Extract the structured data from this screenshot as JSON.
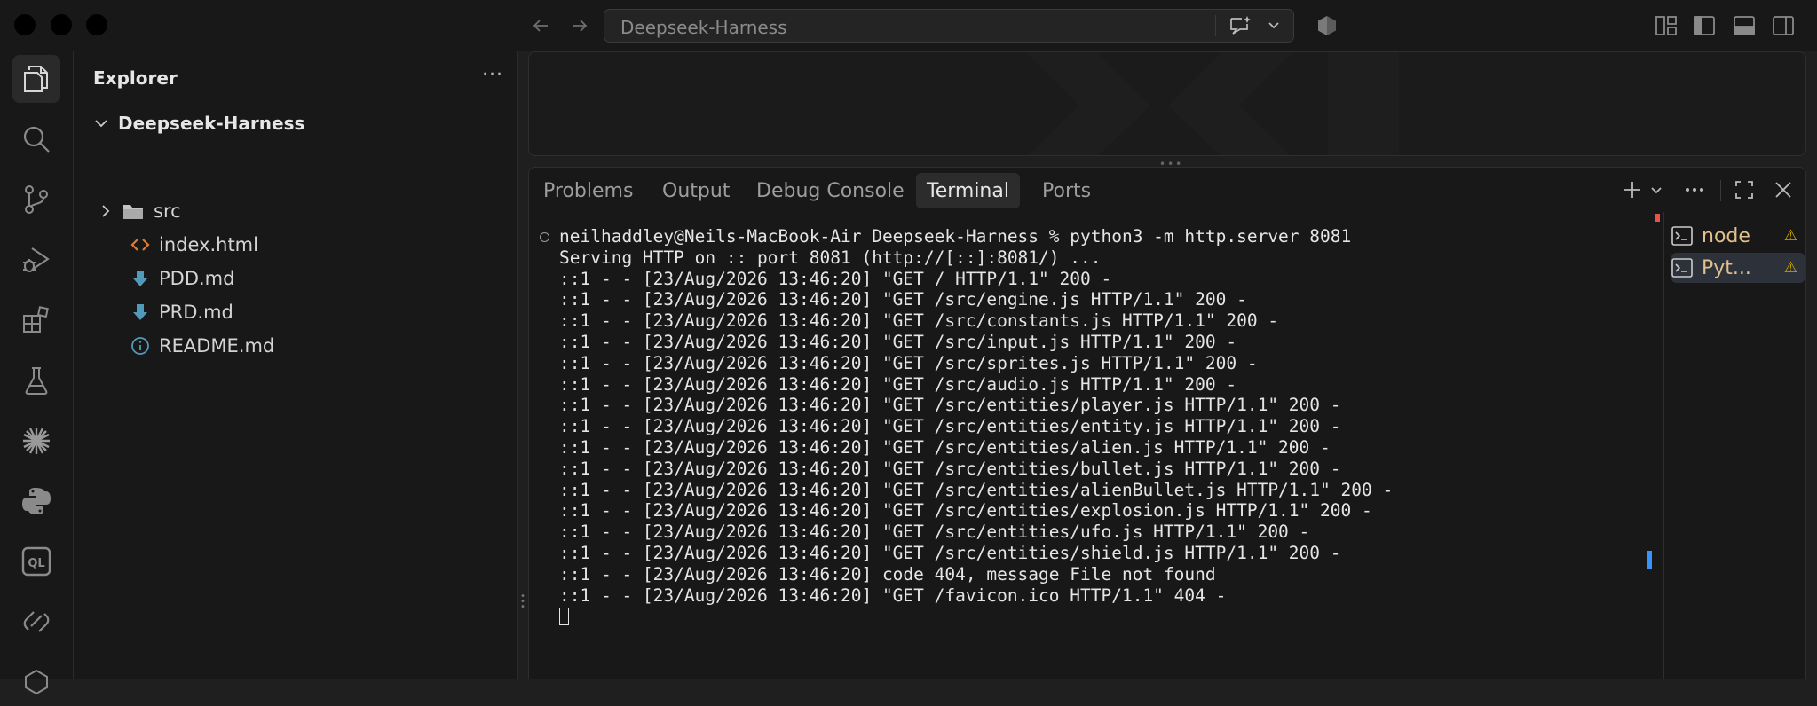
{
  "titlebar": {
    "search_text": "Deepseek-Harness"
  },
  "activity_bar": {
    "items": [
      "explorer",
      "search",
      "source-control",
      "run-debug",
      "extensions",
      "testing",
      "ai-assistant",
      "python",
      "codeql",
      "remote"
    ]
  },
  "sidebar": {
    "title": "Explorer",
    "more": "···",
    "workspace": "Deepseek-Harness",
    "items": [
      {
        "label": "src",
        "icon": "folder-icon",
        "type": "folder"
      },
      {
        "label": "index.html",
        "icon": "html-file-icon",
        "type": "file"
      },
      {
        "label": "PDD.md",
        "icon": "markdown-download-icon",
        "type": "file"
      },
      {
        "label": "PRD.md",
        "icon": "markdown-download-icon",
        "type": "file"
      },
      {
        "label": "README.md",
        "icon": "info-icon",
        "type": "file"
      }
    ]
  },
  "panel": {
    "tabs": [
      "Problems",
      "Output",
      "Debug Console",
      "Terminal",
      "Ports"
    ],
    "active_tab": "Terminal",
    "terminal_lines": [
      "neilhaddley@Neils-MacBook-Air Deepseek-Harness % python3 -m http.server 8081",
      "Serving HTTP on :: port 8081 (http://[::]:8081/) ...",
      "::1 - - [23/Aug/2026 13:46:20] \"GET / HTTP/1.1\" 200 -",
      "::1 - - [23/Aug/2026 13:46:20] \"GET /src/engine.js HTTP/1.1\" 200 -",
      "::1 - - [23/Aug/2026 13:46:20] \"GET /src/constants.js HTTP/1.1\" 200 -",
      "::1 - - [23/Aug/2026 13:46:20] \"GET /src/input.js HTTP/1.1\" 200 -",
      "::1 - - [23/Aug/2026 13:46:20] \"GET /src/sprites.js HTTP/1.1\" 200 -",
      "::1 - - [23/Aug/2026 13:46:20] \"GET /src/audio.js HTTP/1.1\" 200 -",
      "::1 - - [23/Aug/2026 13:46:20] \"GET /src/entities/player.js HTTP/1.1\" 200 -",
      "::1 - - [23/Aug/2026 13:46:20] \"GET /src/entities/entity.js HTTP/1.1\" 200 -",
      "::1 - - [23/Aug/2026 13:46:20] \"GET /src/entities/alien.js HTTP/1.1\" 200 -",
      "::1 - - [23/Aug/2026 13:46:20] \"GET /src/entities/bullet.js HTTP/1.1\" 200 -",
      "::1 - - [23/Aug/2026 13:46:20] \"GET /src/entities/alienBullet.js HTTP/1.1\" 200 -",
      "::1 - - [23/Aug/2026 13:46:20] \"GET /src/entities/explosion.js HTTP/1.1\" 200 -",
      "::1 - - [23/Aug/2026 13:46:20] \"GET /src/entities/ufo.js HTTP/1.1\" 200 -",
      "::1 - - [23/Aug/2026 13:46:20] \"GET /src/entities/shield.js HTTP/1.1\" 200 -",
      "::1 - - [23/Aug/2026 13:46:20] code 404, message File not found",
      "::1 - - [23/Aug/2026 13:46:20] \"GET /favicon.ico HTTP/1.1\" 404 -"
    ],
    "sessions": [
      {
        "label": "node",
        "icon": "terminal-icon",
        "status": "warning-icon"
      },
      {
        "label": "Pyt...",
        "icon": "terminal-icon",
        "status": "warning-icon"
      }
    ]
  },
  "colors": {
    "background": "#1f1f1f",
    "sidebar": "#181818",
    "accent": "#3794ff",
    "warning": "#cca700",
    "session_text": "#e2c08d"
  }
}
